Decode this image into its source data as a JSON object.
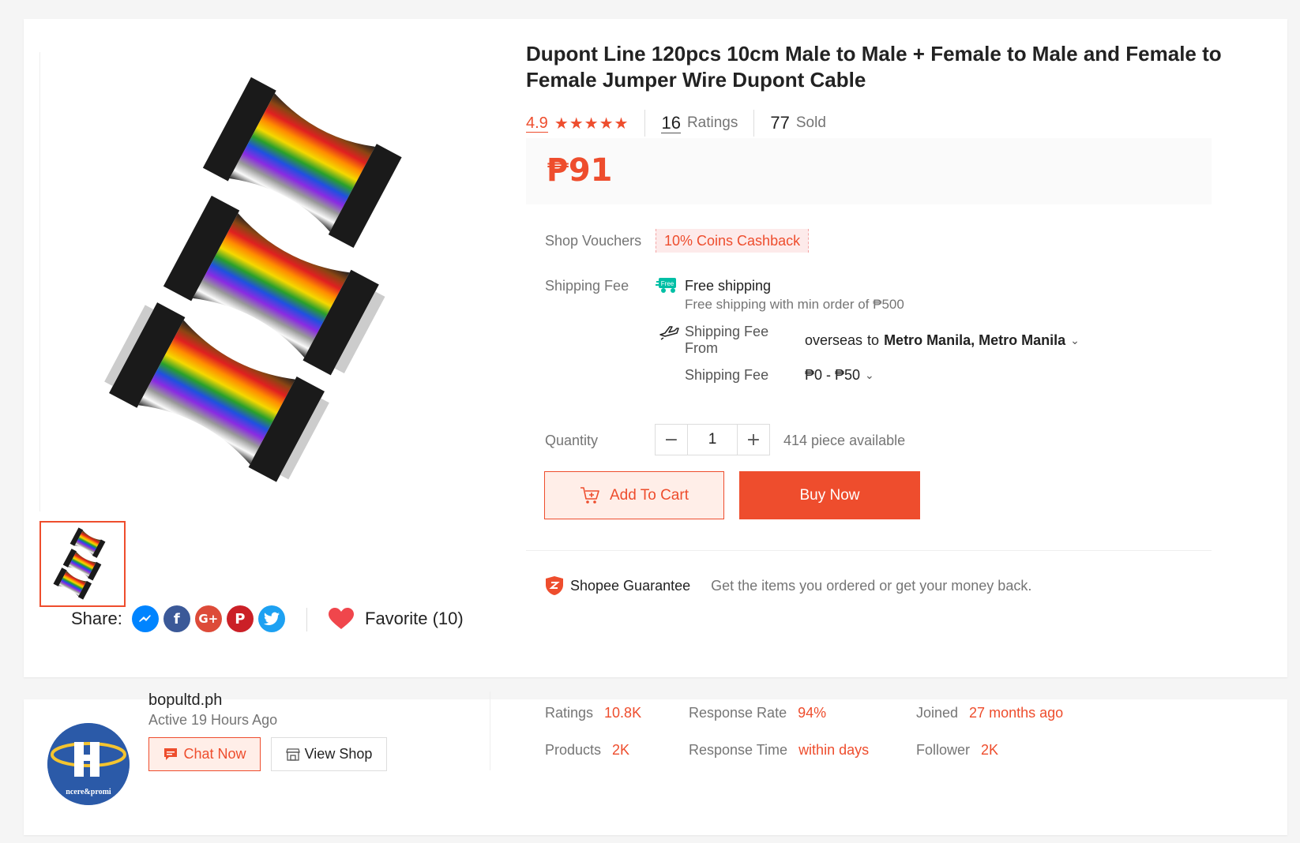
{
  "product": {
    "title": "Dupont Line 120pcs 10cm Male to Male + Female to Male and Female to Female Jumper Wire Dupont Cable",
    "rating": "4.9",
    "stars": "★★★★★",
    "ratings_count": "16",
    "ratings_label": "Ratings",
    "sold_count": "77",
    "sold_label": "Sold",
    "price": "₱91"
  },
  "vouchers": {
    "label": "Shop Vouchers",
    "tag": "10% Coins Cashback"
  },
  "shipping": {
    "label": "Shipping Fee",
    "free_badge": "Free",
    "free_title": "Free shipping",
    "free_subtitle": "Free shipping with min order of ₱500",
    "from_label_line1": "Shipping Fee",
    "from_label_line2": "From",
    "from_origin": "overseas",
    "from_to": "to",
    "destination": "Metro Manila, Metro Manila",
    "fee_label": "Shipping Fee",
    "fee_range": "₱0 - ₱50"
  },
  "quantity": {
    "label": "Quantity",
    "minus": "−",
    "plus": "+",
    "value": "1",
    "available": "414 piece available"
  },
  "actions": {
    "add_to_cart": "Add To Cart",
    "buy_now": "Buy Now"
  },
  "guarantee": {
    "title": "Shopee Guarantee",
    "text": "Get the items you ordered or get your money back."
  },
  "share": {
    "label": "Share:",
    "icons": [
      "messenger-icon",
      "facebook-icon",
      "google-plus-icon",
      "pinterest-icon",
      "twitter-icon"
    ],
    "facebook_glyph": "f",
    "google_glyph": "G+",
    "pinterest_glyph": "P"
  },
  "favorite": {
    "label": "Favorite (10)"
  },
  "shop": {
    "name": "bopultd.ph",
    "active": "Active 19 Hours Ago",
    "chat_now": "Chat Now",
    "view_shop": "View Shop",
    "avatar_text": "ncere&promi",
    "stats": {
      "ratings_label": "Ratings",
      "ratings_value": "10.8K",
      "products_label": "Products",
      "products_value": "2K",
      "response_rate_label": "Response Rate",
      "response_rate_value": "94%",
      "response_time_label": "Response Time",
      "response_time_value": "within days",
      "joined_label": "Joined",
      "joined_value": "27 months ago",
      "follower_label": "Follower",
      "follower_value": "2K"
    }
  },
  "colors": {
    "accent": "#ee4d2d",
    "messenger": "#0084ff",
    "facebook": "#3b5998",
    "google_plus": "#dd4b39",
    "pinterest": "#cb2027",
    "twitter": "#1da1f2",
    "heart": "#f0464c"
  }
}
